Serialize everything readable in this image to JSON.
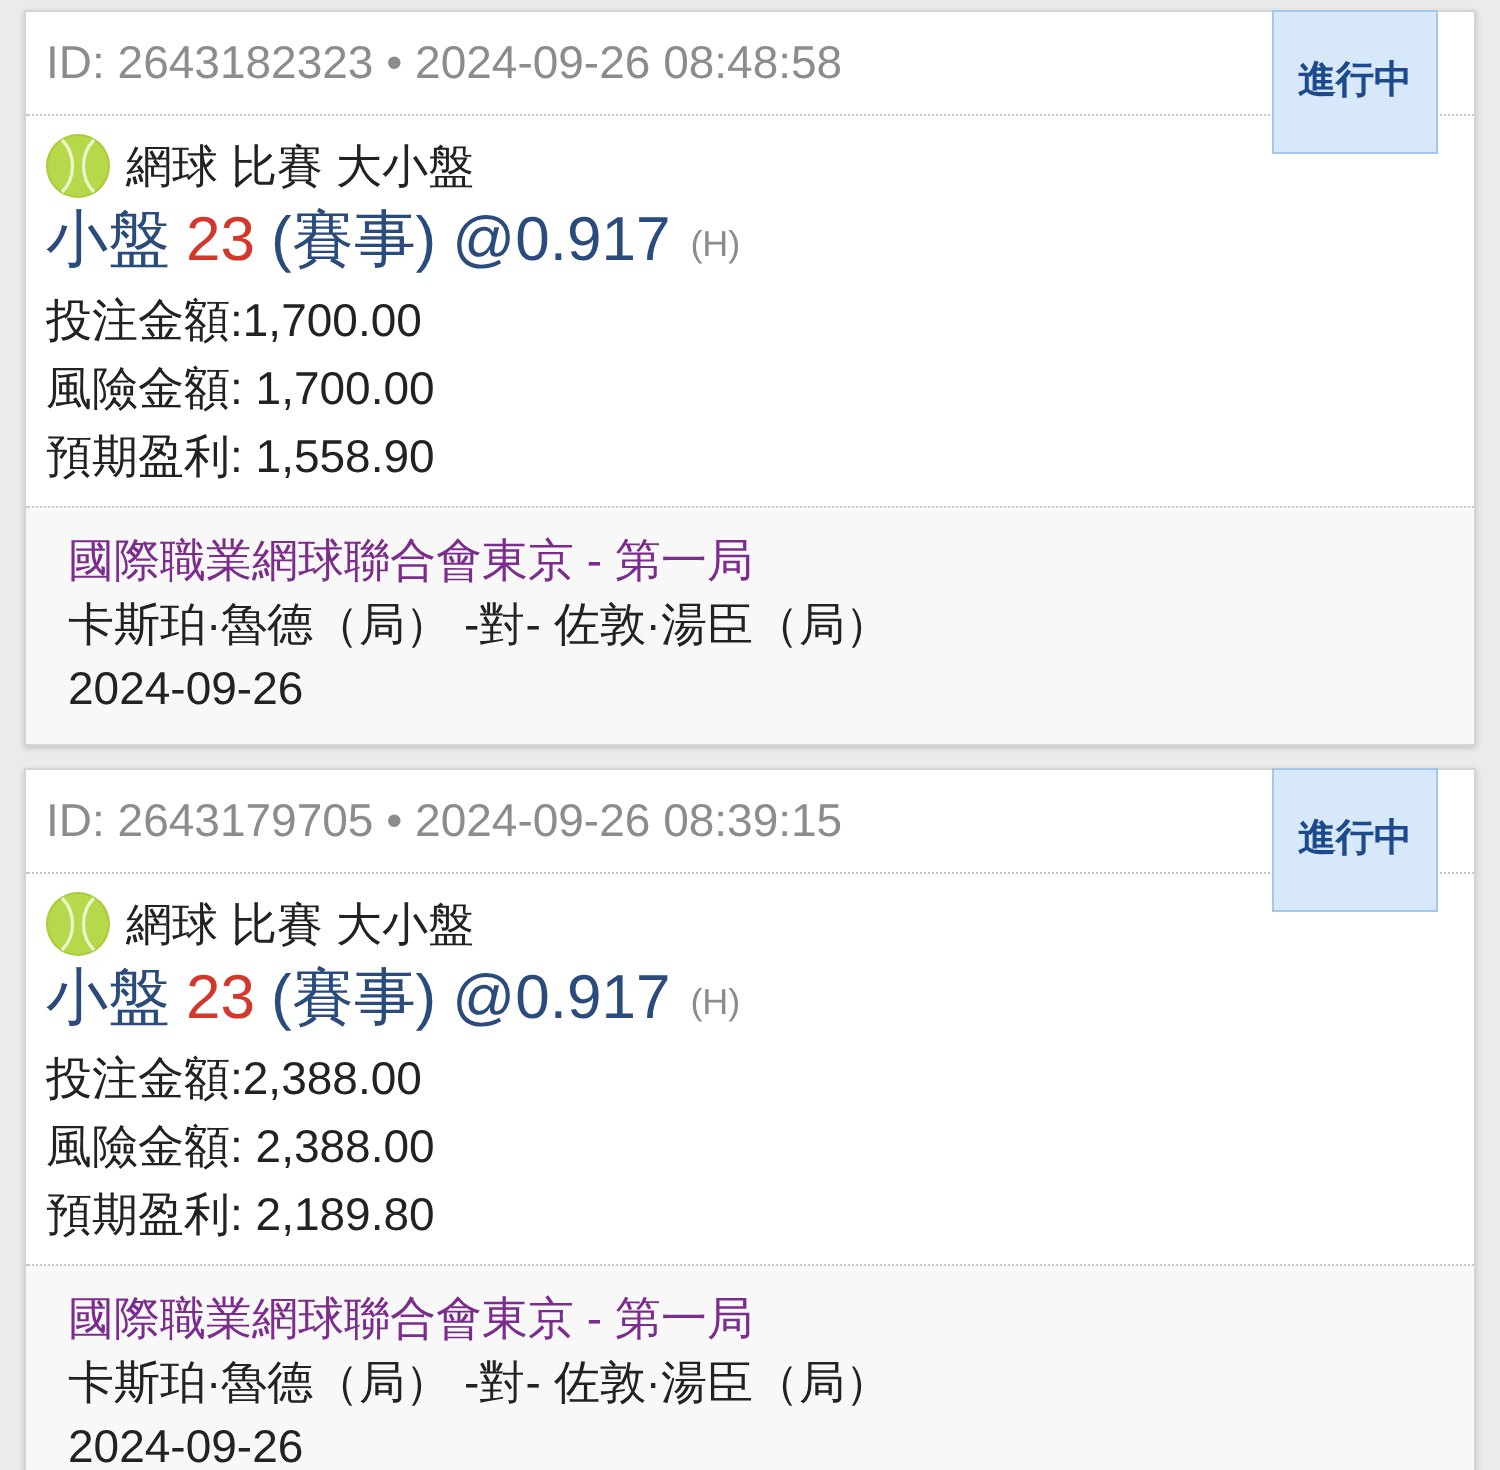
{
  "bets": [
    {
      "header": "ID: 2643182323 • 2024-09-26 08:48:58",
      "status": "進行中",
      "sport_market": "網球 比賽 大小盤",
      "selection": "小盤",
      "handicap": "23",
      "period": "(賽事)",
      "odds": "@0.917",
      "odds_type": "(H)",
      "amounts": [
        "投注金額:1,700.00",
        "風險金額: 1,700.00",
        "預期盈利: 1,558.90"
      ],
      "league": "國際職業網球聯合會東京 - 第一局",
      "matchup": "卡斯珀·魯德（局） -對- 佐敦·湯臣（局）",
      "date": "2024-09-26"
    },
    {
      "header": "ID: 2643179705 • 2024-09-26 08:39:15",
      "status": "進行中",
      "sport_market": "網球 比賽 大小盤",
      "selection": "小盤",
      "handicap": "23",
      "period": "(賽事)",
      "odds": "@0.917",
      "odds_type": "(H)",
      "amounts": [
        "投注金額:2,388.00",
        "風險金額: 2,388.00",
        "預期盈利: 2,189.80"
      ],
      "league": "國際職業網球聯合會東京 - 第一局",
      "matchup": "卡斯珀·魯德（局） -對- 佐敦·湯臣（局）",
      "date": "2024-09-26"
    }
  ]
}
